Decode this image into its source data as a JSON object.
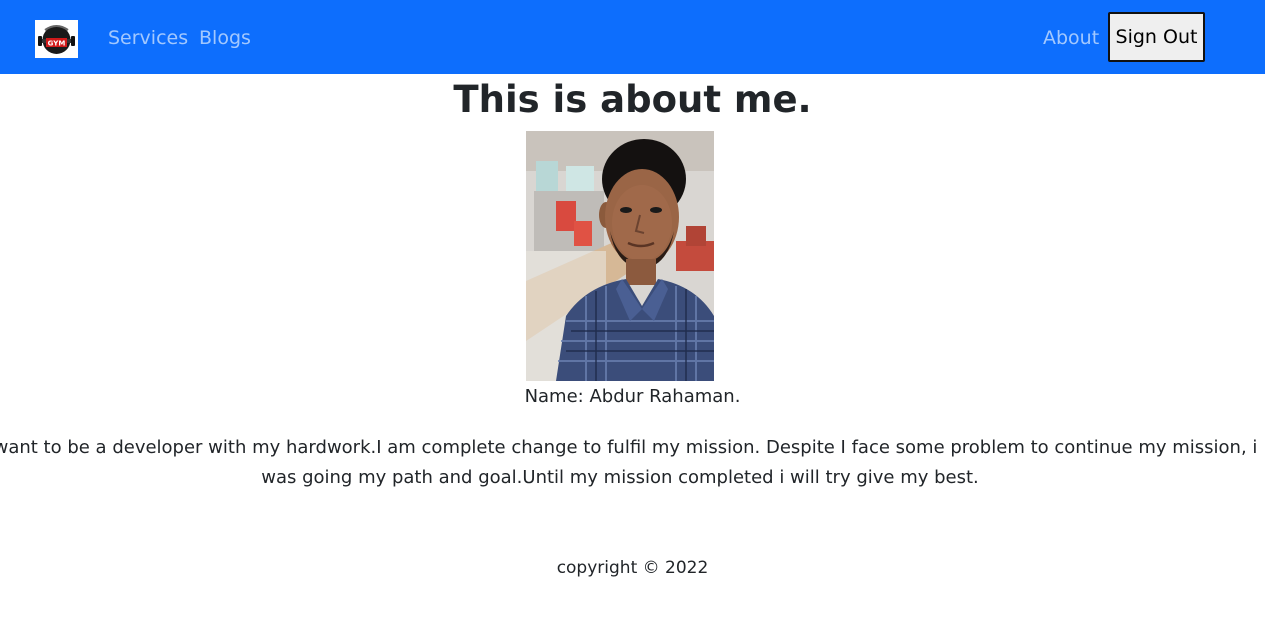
{
  "navbar": {
    "logo_text": "GYM",
    "links": [
      "Services",
      "Blogs"
    ],
    "about_label": "About",
    "signout_label": "Sign Out",
    "background": "#0d6efd"
  },
  "main": {
    "title": "This is about me.",
    "name": "Name: Abdur Rahaman.",
    "bio": "I want to be a developer with my hardwork.I am complete change to fulfil my mission. Despite I face some problem to continue my mission, i was going my path and goal.Until my mission completed i will try give my best."
  },
  "footer": {
    "copyright": "copyright © 2022"
  }
}
